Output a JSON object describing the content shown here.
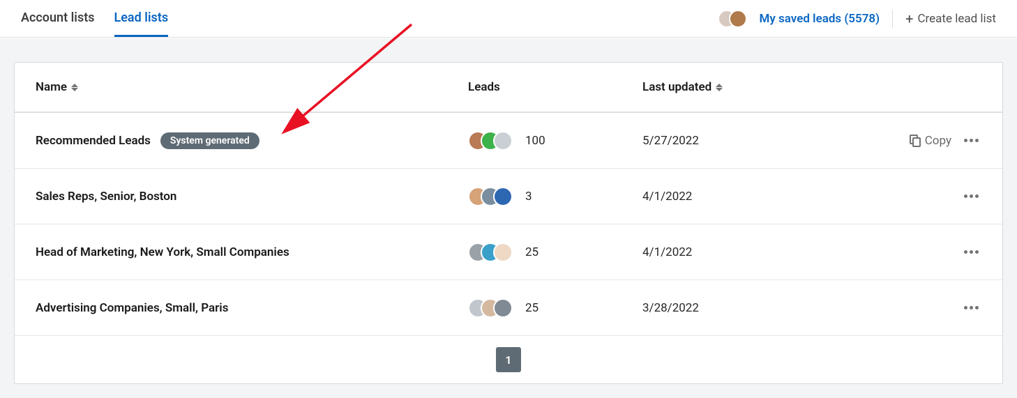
{
  "tabs": {
    "account_lists": "Account lists",
    "lead_lists": "Lead lists"
  },
  "top_right": {
    "saved_leads_label": "My saved leads (5578)",
    "create_button": "Create lead list"
  },
  "table": {
    "headers": {
      "name": "Name",
      "leads": "Leads",
      "last_updated": "Last updated"
    },
    "rows": [
      {
        "name": "Recommended Leads",
        "badge": "System generated",
        "lead_count": "100",
        "last_updated": "5/27/2022",
        "copy_label": "Copy",
        "show_copy": true,
        "avatars": [
          "#b97a56",
          "#3db14a",
          "#c9cfd4"
        ]
      },
      {
        "name": "Sales Reps, Senior, Boston",
        "badge": "",
        "lead_count": "3",
        "last_updated": "4/1/2022",
        "copy_label": "",
        "show_copy": false,
        "avatars": [
          "#d6a277",
          "#7a8ea0",
          "#2e67b1"
        ]
      },
      {
        "name": "Head of Marketing, New York, Small Companies",
        "badge": "",
        "lead_count": "25",
        "last_updated": "4/1/2022",
        "copy_label": "",
        "show_copy": false,
        "avatars": [
          "#9aa2a8",
          "#3aa0c9",
          "#efd8c4"
        ]
      },
      {
        "name": "Advertising Companies, Small, Paris",
        "badge": "",
        "lead_count": "25",
        "last_updated": "3/28/2022",
        "copy_label": "",
        "show_copy": false,
        "avatars": [
          "#c0c6cc",
          "#d4b9a0",
          "#808a94"
        ]
      }
    ]
  },
  "pagination": {
    "current": "1"
  },
  "top_avatars": [
    "#d8c9c0",
    "#b07a4a"
  ]
}
